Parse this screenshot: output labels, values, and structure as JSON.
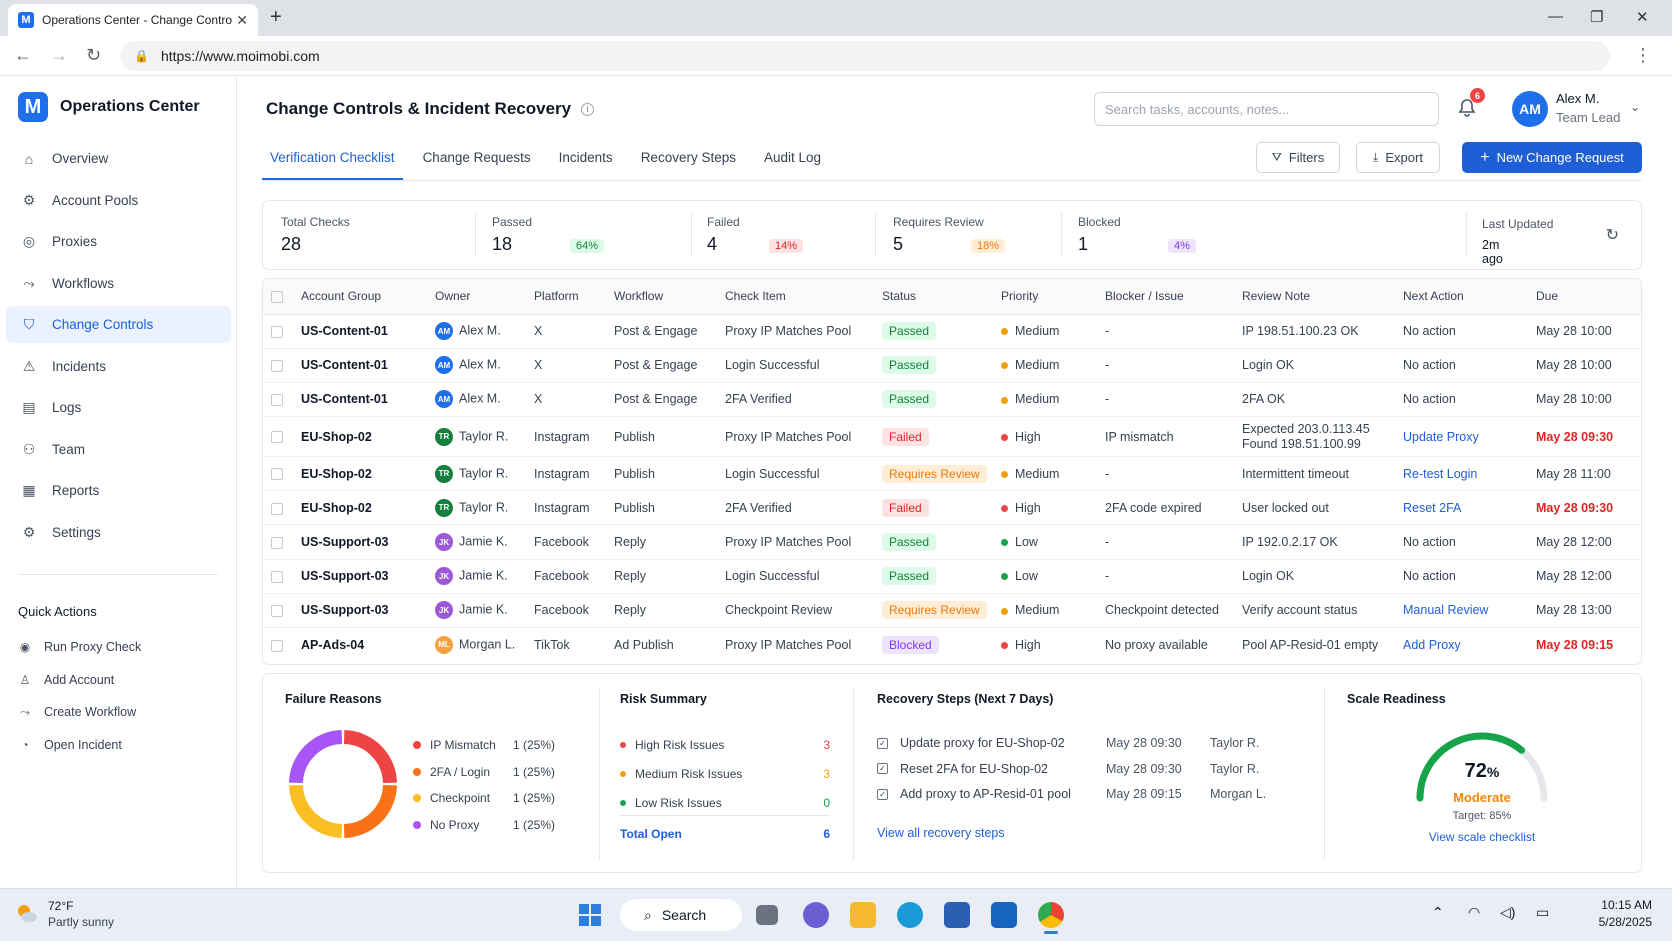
{
  "browser": {
    "tab_title": "Operations Center - Change Controls",
    "url": "https://www.moimobi.com"
  },
  "sidebar": {
    "brand_logo": "M",
    "brand": "Operations Center",
    "items": [
      {
        "label": "Overview",
        "icon": "home-icon"
      },
      {
        "label": "Account Pools",
        "icon": "account-pools-icon"
      },
      {
        "label": "Proxies",
        "icon": "globe-icon"
      },
      {
        "label": "Workflows",
        "icon": "workflow-icon"
      },
      {
        "label": "Change Controls",
        "icon": "shield-icon"
      },
      {
        "label": "Incidents",
        "icon": "warning-icon"
      },
      {
        "label": "Logs",
        "icon": "document-icon"
      },
      {
        "label": "Team",
        "icon": "users-icon"
      },
      {
        "label": "Reports",
        "icon": "report-icon"
      },
      {
        "label": "Settings",
        "icon": "gear-icon"
      }
    ],
    "quick_actions_title": "Quick Actions",
    "quick_actions": [
      {
        "label": "Run Proxy Check",
        "icon": "target-icon"
      },
      {
        "label": "Add Account",
        "icon": "user-icon"
      },
      {
        "label": "Create Workflow",
        "icon": "workflow-icon"
      },
      {
        "label": "Open Incident",
        "icon": "bell-icon"
      }
    ]
  },
  "header": {
    "title": "Change Controls & Incident Recovery",
    "search_placeholder": "Search tasks, accounts, notes...",
    "notifications": "6",
    "user_initials": "AM",
    "user_name": "Alex M.",
    "user_role": "Team Lead"
  },
  "tabs": [
    {
      "label": "Verification Checklist",
      "active": true
    },
    {
      "label": "Change Requests",
      "active": false
    },
    {
      "label": "Incidents",
      "active": false
    },
    {
      "label": "Recovery Steps",
      "active": false
    },
    {
      "label": "Audit Log",
      "active": false
    }
  ],
  "actions": {
    "filters": "Filters",
    "export": "Export",
    "new_request": "New Change Request"
  },
  "summary": {
    "total_label": "Total Checks",
    "total_value": "28",
    "passed_label": "Passed",
    "passed_value": "18",
    "passed_pct": "64%",
    "failed_label": "Failed",
    "failed_value": "4",
    "failed_pct": "14%",
    "review_label": "Requires Review",
    "review_value": "5",
    "review_pct": "18%",
    "blocked_label": "Blocked",
    "blocked_value": "1",
    "blocked_pct": "4%",
    "updated_label": "Last Updated",
    "updated_value": "2m ago"
  },
  "table": {
    "columns": [
      "Account Group",
      "Owner",
      "Platform",
      "Workflow",
      "Check Item",
      "Status",
      "Priority",
      "Blocker / Issue",
      "Review Note",
      "Next Action",
      "Due"
    ],
    "rows": [
      {
        "group": "US-Content-01",
        "owner_initials": "AM",
        "owner": "Alex M.",
        "platform": "X",
        "workflow": "Post & Engage",
        "check": "Proxy IP Matches Pool",
        "status": "Passed",
        "priority": "Medium",
        "blocker": "-",
        "note": "IP 198.51.100.23 OK",
        "note2": "",
        "action": "No action",
        "action_link": false,
        "due": "May 28 10:00",
        "due_urgent": false
      },
      {
        "group": "US-Content-01",
        "owner_initials": "AM",
        "owner": "Alex M.",
        "platform": "X",
        "workflow": "Post & Engage",
        "check": "Login Successful",
        "status": "Passed",
        "priority": "Medium",
        "blocker": "-",
        "note": "Login OK",
        "note2": "",
        "action": "No action",
        "action_link": false,
        "due": "May 28 10:00",
        "due_urgent": false
      },
      {
        "group": "US-Content-01",
        "owner_initials": "AM",
        "owner": "Alex M.",
        "platform": "X",
        "workflow": "Post & Engage",
        "check": "2FA Verified",
        "status": "Passed",
        "priority": "Medium",
        "blocker": "-",
        "note": "2FA OK",
        "note2": "",
        "action": "No action",
        "action_link": false,
        "due": "May 28 10:00",
        "due_urgent": false
      },
      {
        "group": "EU-Shop-02",
        "owner_initials": "TR",
        "owner": "Taylor R.",
        "platform": "Instagram",
        "workflow": "Publish",
        "check": "Proxy IP Matches Pool",
        "status": "Failed",
        "priority": "High",
        "blocker": "IP mismatch",
        "note": "Expected 203.0.113.45",
        "note2": "Found 198.51.100.99",
        "action": "Update Proxy",
        "action_link": true,
        "due": "May 28 09:30",
        "due_urgent": true
      },
      {
        "group": "EU-Shop-02",
        "owner_initials": "TR",
        "owner": "Taylor R.",
        "platform": "Instagram",
        "workflow": "Publish",
        "check": "Login Successful",
        "status": "Requires Review",
        "priority": "Medium",
        "blocker": "-",
        "note": "Intermittent timeout",
        "note2": "",
        "action": "Re-test Login",
        "action_link": true,
        "due": "May 28 11:00",
        "due_urgent": false
      },
      {
        "group": "EU-Shop-02",
        "owner_initials": "TR",
        "owner": "Taylor R.",
        "platform": "Instagram",
        "workflow": "Publish",
        "check": "2FA Verified",
        "status": "Failed",
        "priority": "High",
        "blocker": "2FA code expired",
        "note": "User locked out",
        "note2": "",
        "action": "Reset 2FA",
        "action_link": true,
        "due": "May 28 09:30",
        "due_urgent": true
      },
      {
        "group": "US-Support-03",
        "owner_initials": "JK",
        "owner": "Jamie K.",
        "platform": "Facebook",
        "workflow": "Reply",
        "check": "Proxy IP Matches Pool",
        "status": "Passed",
        "priority": "Low",
        "blocker": "-",
        "note": "IP 192.0.2.17 OK",
        "note2": "",
        "action": "No action",
        "action_link": false,
        "due": "May 28 12:00",
        "due_urgent": false
      },
      {
        "group": "US-Support-03",
        "owner_initials": "JK",
        "owner": "Jamie K.",
        "platform": "Facebook",
        "workflow": "Reply",
        "check": "Login Successful",
        "status": "Passed",
        "priority": "Low",
        "blocker": "-",
        "note": "Login OK",
        "note2": "",
        "action": "No action",
        "action_link": false,
        "due": "May 28 12:00",
        "due_urgent": false
      },
      {
        "group": "US-Support-03",
        "owner_initials": "JK",
        "owner": "Jamie K.",
        "platform": "Facebook",
        "workflow": "Reply",
        "check": "Checkpoint Review",
        "status": "Requires Review",
        "priority": "Medium",
        "blocker": "Checkpoint detected",
        "note": "Verify account status",
        "note2": "",
        "action": "Manual Review",
        "action_link": true,
        "due": "May 28 13:00",
        "due_urgent": false
      },
      {
        "group": "AP-Ads-04",
        "owner_initials": "ML",
        "owner": "Morgan L.",
        "platform": "TikTok",
        "workflow": "Ad Publish",
        "check": "Proxy IP Matches Pool",
        "status": "Blocked",
        "priority": "High",
        "blocker": "No proxy available",
        "note": "Pool AP-Resid-01 empty",
        "note2": "",
        "action": "Add Proxy",
        "action_link": true,
        "due": "May 28 09:15",
        "due_urgent": true
      }
    ]
  },
  "colors": {
    "accent": "#1f5fd6",
    "passed_bg": "#dcfce7",
    "passed_fg": "#15803d",
    "failed_bg": "#fee2e2",
    "failed_fg": "#dc2626",
    "review_bg": "#ffedd5",
    "review_fg": "#ea7a0c",
    "blocked_bg": "#ede4fb",
    "blocked_fg": "#7c3aed",
    "high": "#ef4444",
    "medium": "#f59e0b",
    "low": "#16a34a",
    "owner_AM": "#1f6feb",
    "owner_TR": "#15803d",
    "owner_JK": "#9b59d6",
    "owner_ML": "#f59e42"
  },
  "failure_reasons": {
    "title": "Failure Reasons",
    "items": [
      {
        "label": "IP Mismatch",
        "value": "1 (25%)",
        "share": 25,
        "color": "#ef4444"
      },
      {
        "label": "2FA / Login",
        "value": "1 (25%)",
        "share": 25,
        "color": "#f97316"
      },
      {
        "label": "Checkpoint",
        "value": "1 (25%)",
        "share": 25,
        "color": "#fbbf24"
      },
      {
        "label": "No Proxy",
        "value": "1 (25%)",
        "share": 25,
        "color": "#a855f7"
      }
    ]
  },
  "risk_summary": {
    "title": "Risk Summary",
    "items": [
      {
        "label": "High Risk Issues",
        "value": "3",
        "color": "#ef4444"
      },
      {
        "label": "Medium Risk Issues",
        "value": "3",
        "color": "#f59e0b"
      },
      {
        "label": "Low Risk Issues",
        "value": "0",
        "color": "#16a34a"
      }
    ],
    "total_label": "Total Open",
    "total_value": "6"
  },
  "recovery": {
    "title": "Recovery Steps (Next 7 Days)",
    "items": [
      {
        "task": "Update proxy for EU-Shop-02",
        "time": "May 28 09:30",
        "owner": "Taylor R."
      },
      {
        "task": "Reset 2FA for EU-Shop-02",
        "time": "May 28 09:30",
        "owner": "Taylor R."
      },
      {
        "task": "Add proxy to AP-Resid-01 pool",
        "time": "May 28 09:15",
        "owner": "Morgan L."
      }
    ],
    "link": "View all recovery steps"
  },
  "scale": {
    "title": "Scale Readiness",
    "value": "72",
    "value_fraction": 0.72,
    "unit": "%",
    "status": "Moderate",
    "target": "Target: 85%",
    "link": "View scale checklist"
  },
  "taskbar": {
    "temp": "72°F",
    "weather": "Partly sunny",
    "search": "Search",
    "time": "10:15 AM",
    "date": "5/28/2025"
  }
}
